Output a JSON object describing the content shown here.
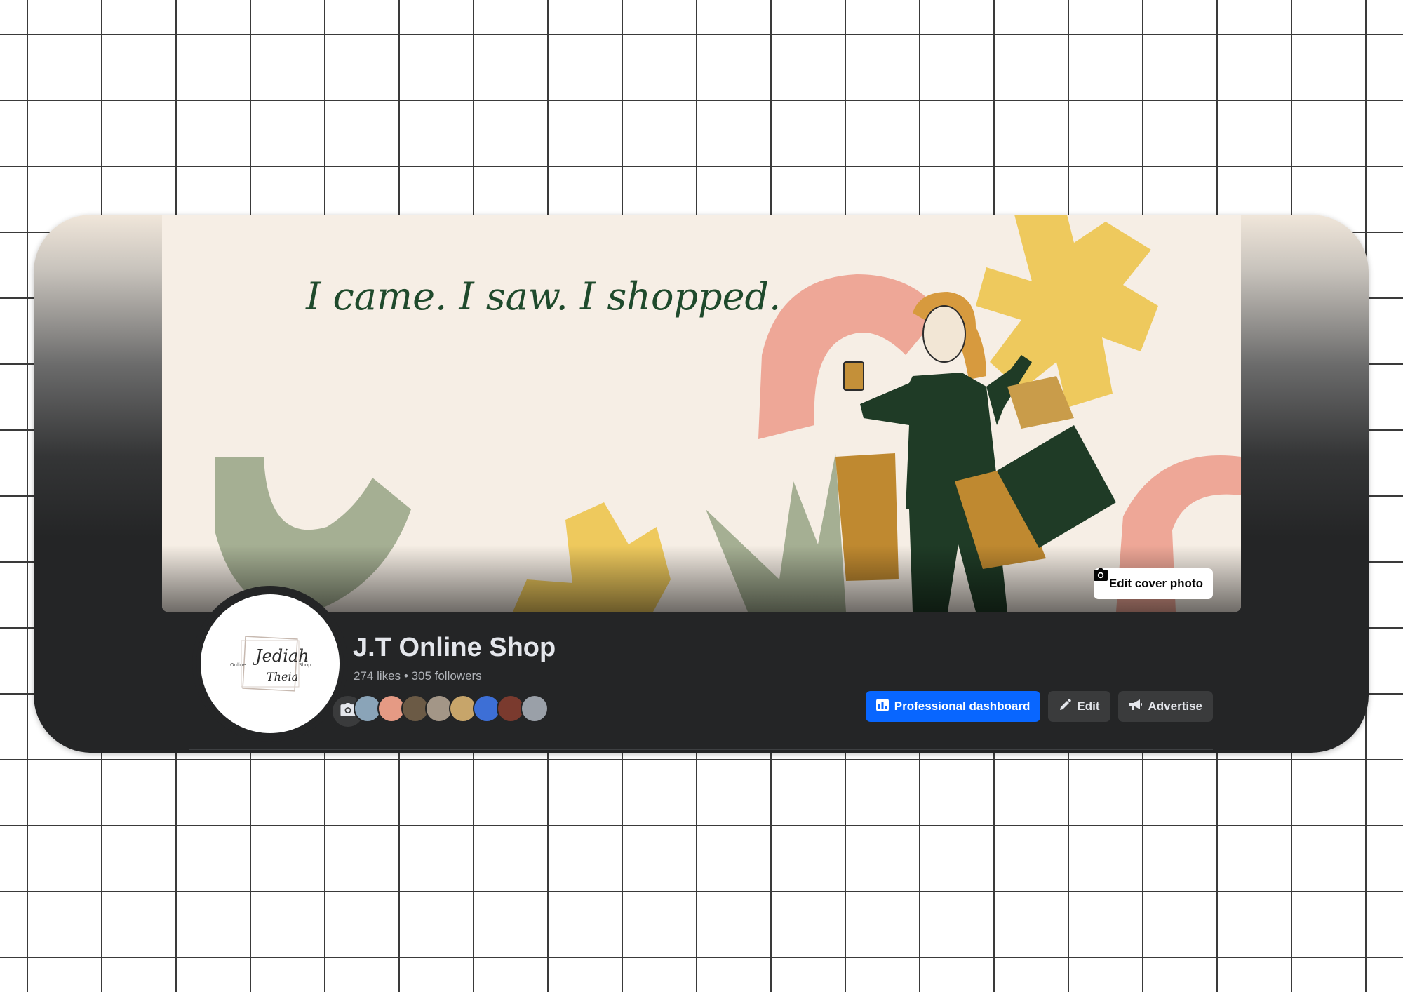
{
  "page": {
    "name": "J.T Online Shop",
    "likes": "274 likes",
    "separator": "•",
    "followers": "305 followers"
  },
  "cover": {
    "tagline": "I came. I saw. I shopped.",
    "edit_label": "Edit cover photo",
    "edit_icon": "camera-icon"
  },
  "avatar": {
    "logo_script": "Jediah",
    "logo_script_2": "Theia",
    "logo_left": "Online",
    "logo_right": "Shop",
    "camera_icon": "camera-icon"
  },
  "actions": {
    "dashboard_label": "Professional dashboard",
    "dashboard_icon": "chart-icon",
    "edit_label": "Edit",
    "edit_icon": "pencil-icon",
    "advertise_label": "Advertise",
    "advertise_icon": "megaphone-icon"
  },
  "colors": {
    "primary": "#0866ff",
    "surface": "#242526",
    "button": "#3a3b3c",
    "text": "#e4e6eb",
    "muted": "#b0b3b8"
  }
}
